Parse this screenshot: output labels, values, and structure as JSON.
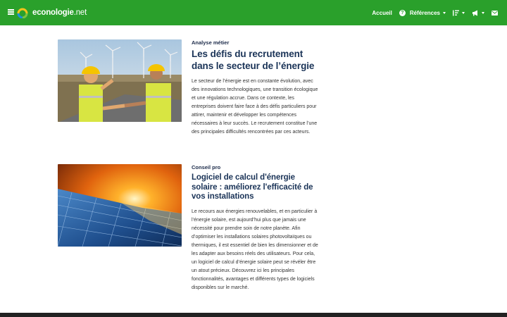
{
  "header": {
    "logo_name": "econologie",
    "logo_tld": ".net",
    "nav": {
      "home": "Accueil",
      "references": "Références"
    },
    "icons": [
      "menu-icon",
      "help-icon",
      "sort-icon",
      "megaphone-icon",
      "mail-icon"
    ],
    "brand_color": "#2aa02b"
  },
  "articles": [
    {
      "category": "Analyse métier",
      "title": "Les défis du recrutement dans le secteur de l’énergie",
      "excerpt": "Le secteur de l’énergie est en constante évolution, avec des innovations technologiques, une transition écologique et une régulation accrue. Dans ce contexte, les entreprises doivent faire face à des défis particuliers pour attirer, maintenir et développer les compétences nécessaires à leur succès. Le recrutement constitue l’une des principales difficultés rencontrées par ces acteurs."
    },
    {
      "category": "Conseil pro",
      "title": "Logiciel de calcul d'énergie solaire : améliorez l'efficacité de vos installations",
      "excerpt": "Le recours aux énergies renouvelables, et en particulier à l’énergie solaire, est aujourd’hui plus que jamais une nécessité pour prendre soin de notre planète. Afin d’optimiser les installations solaires photovoltaïques ou thermiques, il est essentiel de bien les dimensionner et de les adapter aux besoins réels des utilisateurs. Pour cela, un logiciel de calcul d’énergie solaire peut se révéler être un atout précieux. Découvrez ici les principales fonctionnalités, avantages et différents types de logiciels disponibles sur le marché."
    }
  ]
}
